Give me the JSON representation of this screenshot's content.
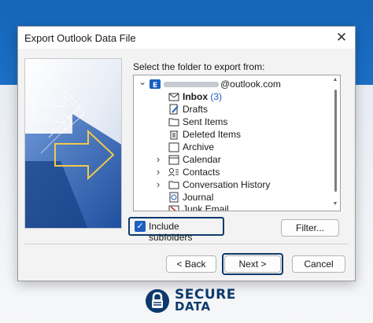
{
  "dialog": {
    "title": "Export Outlook Data File",
    "close_glyph": "✕",
    "prompt": "Select the folder to export from:"
  },
  "account": {
    "name": "@outlook.com",
    "expand_glyph": "⌄",
    "icon": "outlook-account-icon"
  },
  "folders": [
    {
      "label": "Inbox",
      "count": "(3)",
      "bold": true,
      "expandable": false,
      "icon": "envelope-icon"
    },
    {
      "label": "Drafts",
      "expandable": false,
      "icon": "drafts-icon"
    },
    {
      "label": "Sent Items",
      "expandable": false,
      "icon": "sent-folder-icon"
    },
    {
      "label": "Deleted Items",
      "expandable": false,
      "icon": "trash-icon"
    },
    {
      "label": "Archive",
      "expandable": false,
      "icon": "archive-icon"
    },
    {
      "label": "Calendar",
      "expandable": true,
      "icon": "calendar-icon"
    },
    {
      "label": "Contacts",
      "expandable": true,
      "icon": "contacts-icon"
    },
    {
      "label": "Conversation History",
      "expandable": true,
      "icon": "folder-icon"
    },
    {
      "label": "Journal",
      "expandable": false,
      "icon": "journal-icon"
    },
    {
      "label": "Junk Email",
      "expandable": false,
      "icon": "junk-mail-icon"
    }
  ],
  "tree_chevron": "›",
  "subfolders": {
    "label": "Include subfolders",
    "checked": true,
    "check_glyph": "✓"
  },
  "buttons": {
    "filter": "Filter...",
    "back": "< Back",
    "next": "Next >",
    "cancel": "Cancel"
  },
  "logo": {
    "word1": "SECURE",
    "word2": "DATA"
  },
  "colors": {
    "accent": "#1f5fbf",
    "focus_border": "#0d3a6b",
    "count": "#1f55c7",
    "page_blue": "#1565b8"
  }
}
